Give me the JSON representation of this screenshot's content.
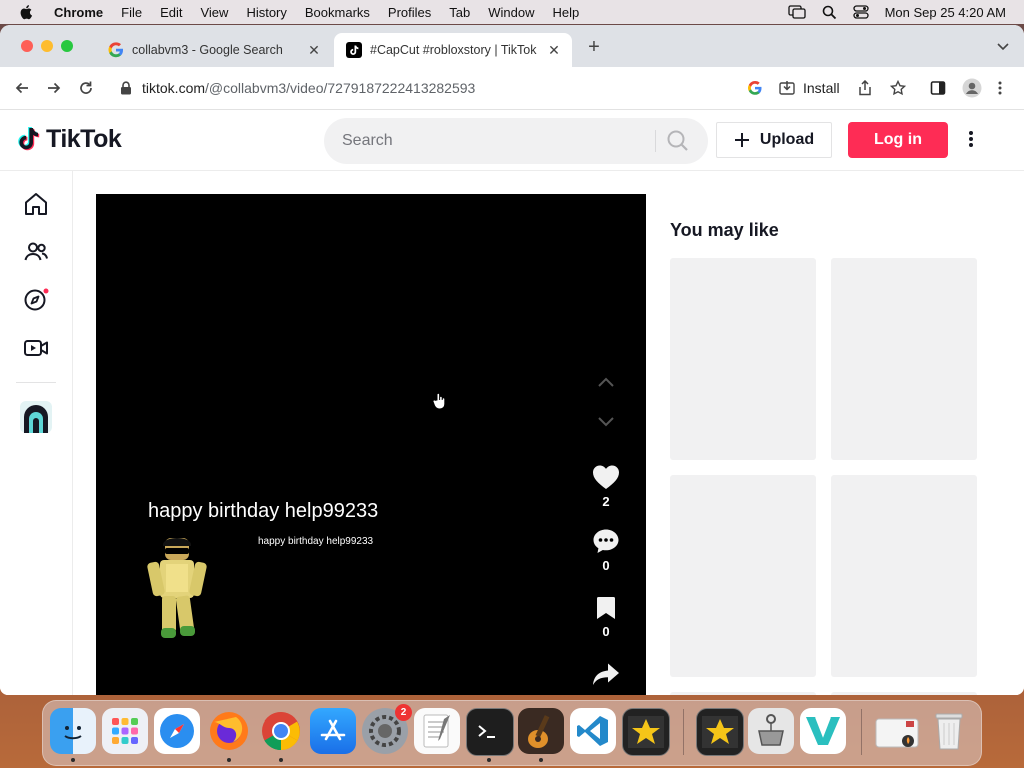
{
  "menubar": {
    "app": "Chrome",
    "items": [
      "File",
      "Edit",
      "View",
      "History",
      "Bookmarks",
      "Profiles",
      "Tab",
      "Window",
      "Help"
    ],
    "datetime": "Mon Sep 25  4:20 AM"
  },
  "browser": {
    "tabs": [
      {
        "title": "collabvm3 - Google Search",
        "favicon": "google-icon",
        "active": false
      },
      {
        "title": "#CapCut #robloxstory | TikTok",
        "favicon": "tiktok-icon",
        "active": true
      }
    ],
    "url_host": "tiktok.com",
    "url_path": "/@collabvm3/video/7279187222413282593",
    "install_label": "Install"
  },
  "tiktok": {
    "logo_text": "TikTok",
    "search_placeholder": "Search",
    "upload_label": "Upload",
    "login_label": "Log in",
    "sidebar_icons": [
      "home-icon",
      "following-icon",
      "explore-icon",
      "live-icon",
      "avatar-icon"
    ],
    "video": {
      "caption_large": "happy birthday help99233",
      "caption_small": "happy birthday help99233",
      "likes": "2",
      "comments": "0",
      "saves": "0"
    },
    "you_may_like_title": "You may like"
  },
  "colors": {
    "accent": "#fe2c55",
    "tiktok_text": "#161823",
    "placeholder_card": "#f1f1f2"
  },
  "dock": {
    "apps": [
      "finder-icon",
      "launchpad-icon",
      "safari-icon",
      "firefox-icon",
      "chrome-icon",
      "app-store-icon",
      "system-preferences-icon",
      "textedit-icon",
      "terminal-icon",
      "garageband-icon",
      "vscode-icon",
      "imovie-icon",
      "imovie-icon",
      "utility-icon",
      "vectorworks-icon",
      "preview-icon",
      "trash-icon"
    ],
    "settings_badge": "2"
  }
}
